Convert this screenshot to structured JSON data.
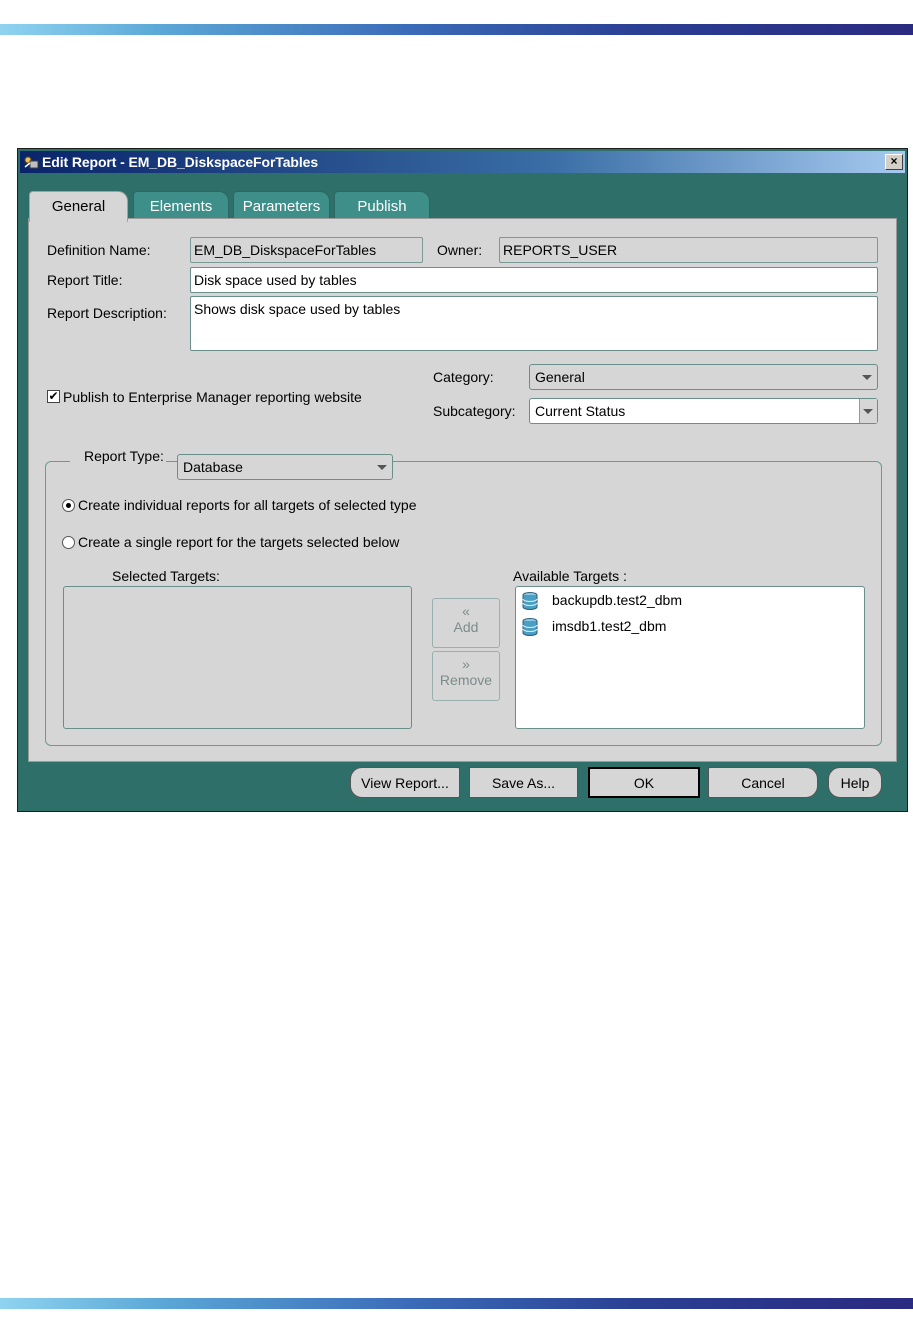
{
  "window": {
    "title": "Edit Report - EM_DB_DiskspaceForTables",
    "close_glyph": "×"
  },
  "tabs": [
    {
      "label": "General",
      "active": true
    },
    {
      "label": "Elements",
      "active": false
    },
    {
      "label": "Parameters",
      "active": false
    },
    {
      "label": "Publish",
      "active": false
    }
  ],
  "general": {
    "definition_name_label": "Definition Name:",
    "definition_name_value": "EM_DB_DiskspaceForTables",
    "owner_label": "Owner:",
    "owner_value": "REPORTS_USER",
    "report_title_label": "Report Title:",
    "report_title_value": "Disk space used by tables",
    "report_description_label": "Report Description:",
    "report_description_value": "Shows disk space used by tables",
    "publish_checked": true,
    "publish_label": "Publish to Enterprise Manager reporting website",
    "category_label": "Category:",
    "category_value": "General",
    "subcategory_label": "Subcategory:",
    "subcategory_value": "Current Status"
  },
  "report_type": {
    "label": "Report Type:",
    "value": "Database",
    "option_individual": "Create individual reports for all targets of selected type",
    "option_single": "Create a single report for the targets selected below",
    "selected_option": "individual",
    "selected_targets_label": "Selected Targets:",
    "available_targets_label": "Available Targets :",
    "available_targets": [
      "backupdb.test2_dbm",
      "imsdb1.test2_dbm"
    ],
    "add_label": "Add",
    "remove_label": "Remove"
  },
  "footer": {
    "view_report": "View Report...",
    "save_as": "Save As...",
    "ok": "OK",
    "cancel": "Cancel",
    "help": "Help"
  },
  "colors": {
    "window_bg": "#2f6f6a",
    "tab_inactive": "#3e8f89",
    "panel_bg": "#d6d6d6",
    "titlebar_start": "#0a246a"
  },
  "icons": {
    "title": "report-wizard-icon",
    "target": "database-icon",
    "add": "chevron-left-icon",
    "remove": "chevron-right-icon"
  }
}
